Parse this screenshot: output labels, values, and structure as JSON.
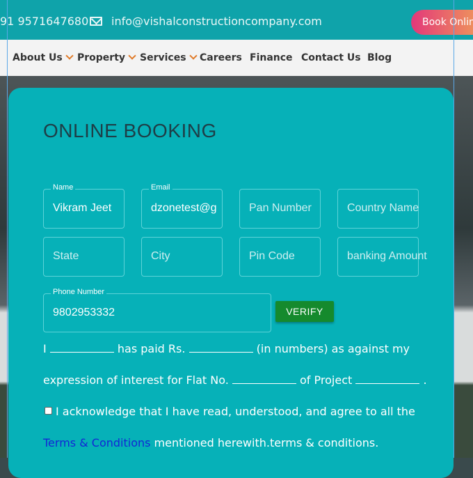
{
  "topbar": {
    "phone": "91 9571647680",
    "email": "info@vishalconstructioncompany.com",
    "book_label": "Book Online"
  },
  "nav": {
    "items": [
      {
        "label": "About Us",
        "dropdown": true
      },
      {
        "label": "Property",
        "dropdown": true
      },
      {
        "label": "Services",
        "dropdown": true
      },
      {
        "label": "Careers",
        "dropdown": false
      },
      {
        "label": "Finance",
        "dropdown": false
      },
      {
        "label": "Contact Us",
        "dropdown": false
      },
      {
        "label": "Blog",
        "dropdown": false
      }
    ]
  },
  "modal": {
    "title": "ONLINE BOOKING",
    "fields": {
      "name": {
        "label": "Name",
        "value": "Vikram Jeet"
      },
      "email": {
        "label": "Email",
        "value": "dzonetest@gmail.com"
      },
      "pan": {
        "placeholder": "Pan Number"
      },
      "country": {
        "placeholder": "Country Name"
      },
      "state": {
        "placeholder": "State"
      },
      "city": {
        "placeholder": "City"
      },
      "pin": {
        "placeholder": "Pin Code"
      },
      "banking": {
        "placeholder": "banking Amount"
      },
      "phone": {
        "label": "Phone Number",
        "value": "9802953332"
      }
    },
    "verify_label": "VERIFY",
    "statement": {
      "p1_a": "I",
      "p1_b": "has paid Rs.",
      "p1_c": "(in numbers) as against my",
      "p2_a": "expression of interest for Flat No.",
      "p2_b": "of Project",
      "p2_c": "."
    },
    "acknowledge": "I acknowledge that I have read, understood, and agree to all the",
    "terms_link": "Terms & Conditions",
    "terms_suffix": "mentioned herewith.terms & conditions."
  }
}
